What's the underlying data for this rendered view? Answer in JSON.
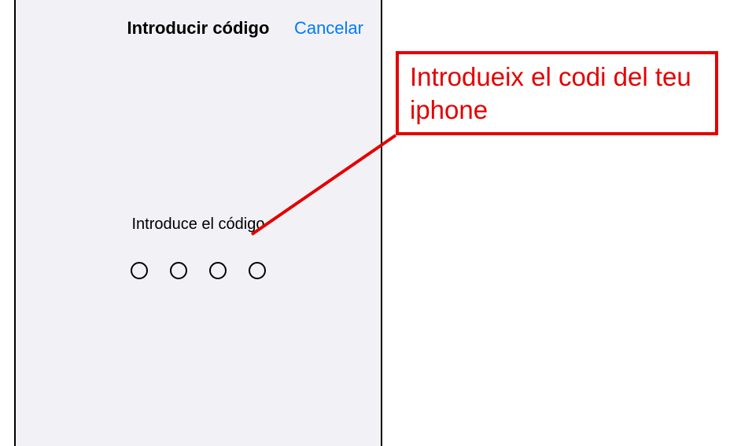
{
  "header": {
    "title": "Introducir código",
    "cancel_label": "Cancelar"
  },
  "content": {
    "prompt": "Introduce el código",
    "passcode_length": 4
  },
  "annotation": {
    "text": "Introdueix el codi del teu iphone",
    "color": "#e30000"
  }
}
